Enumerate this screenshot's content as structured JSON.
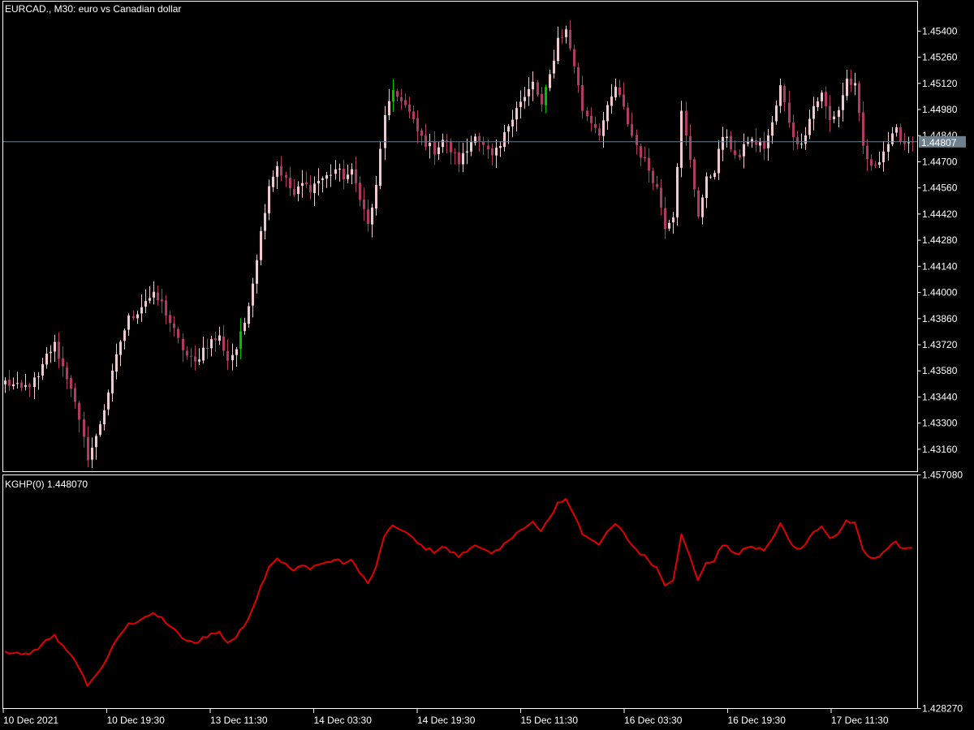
{
  "header": {
    "symbol_label": "EURCAD., M30:  euro vs Canadian dollar",
    "indicator_label": "KGHP(0) 1.448070"
  },
  "colors": {
    "background": "#000000",
    "frame": "#ffffff",
    "bear_candle": "#b03a64",
    "bull_candle": "#f2c8cf",
    "bull_candle_alt": "#00c000",
    "indicator_line": "#e00000",
    "current_price_line": "#6e7f8d",
    "current_price_label_bg": "#6e7f8d",
    "text": "#ffffff"
  },
  "price_axis": {
    "labels": [
      "1.45400",
      "1.45260",
      "1.45120",
      "1.44980",
      "1.44840",
      "1.44700",
      "1.44560",
      "1.44420",
      "1.44280",
      "1.44140",
      "1.44000",
      "1.43860",
      "1.43720",
      "1.43580",
      "1.43440",
      "1.43300",
      "1.43160"
    ],
    "current_price": "1.44807"
  },
  "indicator_axis": {
    "labels": [
      "1.457080",
      "1.428270"
    ]
  },
  "time_axis": {
    "labels": [
      "10 Dec 2021",
      "10 Dec 19:30",
      "13 Dec 11:30",
      "14 Dec 03:30",
      "14 Dec 19:30",
      "15 Dec 11:30",
      "16 Dec 03:30",
      "16 Dec 19:30",
      "17 Dec 11:30"
    ]
  },
  "chart_data": [
    {
      "type": "candlestick",
      "title": "EURCAD., M30:  euro vs Canadian dollar",
      "ylim": [
        1.4304,
        1.4556
      ],
      "current_price": 1.44807,
      "path_points": [
        [
          0,
          1.4352
        ],
        [
          4,
          1.4348
        ],
        [
          8,
          1.4354
        ],
        [
          10,
          1.4366
        ],
        [
          12,
          1.4372
        ],
        [
          14,
          1.436
        ],
        [
          16,
          1.435
        ],
        [
          18,
          1.433
        ],
        [
          20,
          1.4312
        ],
        [
          22,
          1.4322
        ],
        [
          24,
          1.4338
        ],
        [
          26,
          1.4356
        ],
        [
          28,
          1.4374
        ],
        [
          30,
          1.4386
        ],
        [
          32,
          1.439
        ],
        [
          34,
          1.4396
        ],
        [
          36,
          1.4398
        ],
        [
          38,
          1.4394
        ],
        [
          40,
          1.4384
        ],
        [
          42,
          1.4374
        ],
        [
          44,
          1.4366
        ],
        [
          46,
          1.4362
        ],
        [
          48,
          1.437
        ],
        [
          50,
          1.4374
        ],
        [
          52,
          1.4376
        ],
        [
          54,
          1.4364
        ],
        [
          56,
          1.437
        ],
        [
          58,
          1.4384
        ],
        [
          60,
          1.4406
        ],
        [
          62,
          1.4432
        ],
        [
          64,
          1.4458
        ],
        [
          66,
          1.4468
        ],
        [
          68,
          1.446
        ],
        [
          70,
          1.4452
        ],
        [
          72,
          1.4458
        ],
        [
          74,
          1.4456
        ],
        [
          76,
          1.446
        ],
        [
          78,
          1.4462
        ],
        [
          80,
          1.4466
        ],
        [
          82,
          1.4462
        ],
        [
          84,
          1.4464
        ],
        [
          86,
          1.4452
        ],
        [
          88,
          1.4436
        ],
        [
          90,
          1.4456
        ],
        [
          92,
          1.4496
        ],
        [
          94,
          1.4506
        ],
        [
          96,
          1.4504
        ],
        [
          98,
          1.4496
        ],
        [
          100,
          1.4486
        ],
        [
          102,
          1.448
        ],
        [
          104,
          1.4476
        ],
        [
          106,
          1.4482
        ],
        [
          108,
          1.4476
        ],
        [
          110,
          1.447
        ],
        [
          112,
          1.4476
        ],
        [
          114,
          1.4486
        ],
        [
          116,
          1.4478
        ],
        [
          118,
          1.4472
        ],
        [
          120,
          1.4478
        ],
        [
          122,
          1.449
        ],
        [
          124,
          1.45
        ],
        [
          126,
          1.4504
        ],
        [
          128,
          1.4512
        ],
        [
          130,
          1.45
        ],
        [
          132,
          1.4516
        ],
        [
          134,
          1.4536
        ],
        [
          136,
          1.454
        ],
        [
          138,
          1.4522
        ],
        [
          140,
          1.4498
        ],
        [
          142,
          1.4492
        ],
        [
          144,
          1.4486
        ],
        [
          146,
          1.4498
        ],
        [
          148,
          1.451
        ],
        [
          150,
          1.4498
        ],
        [
          152,
          1.4484
        ],
        [
          154,
          1.4474
        ],
        [
          156,
          1.4466
        ],
        [
          158,
          1.4456
        ],
        [
          160,
          1.4436
        ],
        [
          162,
          1.4442
        ],
        [
          164,
          1.4496
        ],
        [
          166,
          1.447
        ],
        [
          168,
          1.4442
        ],
        [
          170,
          1.446
        ],
        [
          172,
          1.4466
        ],
        [
          174,
          1.4484
        ],
        [
          176,
          1.4478
        ],
        [
          178,
          1.4472
        ],
        [
          180,
          1.4482
        ],
        [
          182,
          1.448
        ],
        [
          184,
          1.4478
        ],
        [
          186,
          1.449
        ],
        [
          188,
          1.451
        ],
        [
          190,
          1.4492
        ],
        [
          192,
          1.4478
        ],
        [
          194,
          1.4486
        ],
        [
          196,
          1.45
        ],
        [
          198,
          1.4506
        ],
        [
          200,
          1.4492
        ],
        [
          202,
          1.4498
        ],
        [
          204,
          1.4514
        ],
        [
          206,
          1.451
        ],
        [
          208,
          1.4478
        ],
        [
          210,
          1.4466
        ],
        [
          212,
          1.4472
        ],
        [
          214,
          1.448
        ],
        [
          216,
          1.4486
        ],
        [
          218,
          1.448
        ],
        [
          220,
          1.4482
        ]
      ]
    },
    {
      "type": "line",
      "title": "KGHP(0) 1.448070",
      "ylim": [
        1.42827,
        1.45708
      ],
      "value_offset": 4e-05,
      "line_color": "#e00000"
    }
  ]
}
